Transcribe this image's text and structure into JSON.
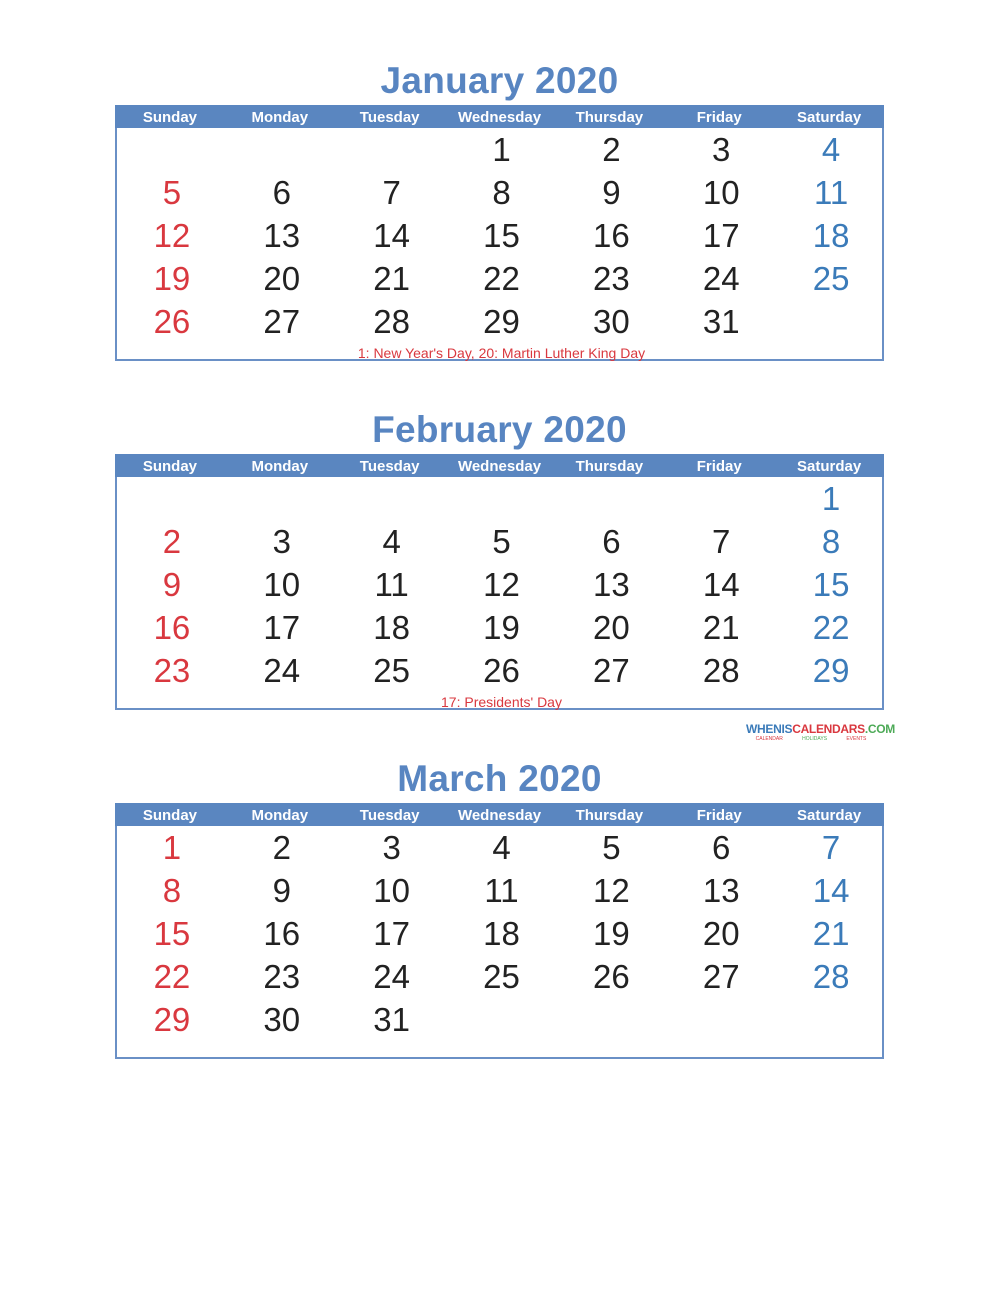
{
  "weekday_headers": [
    "Sunday",
    "Monday",
    "Tuesday",
    "Wednesday",
    "Thursday",
    "Friday",
    "Saturday"
  ],
  "colors": {
    "header_bar": "#5A86C0",
    "title": "#5885C1",
    "sunday": "#D9383F",
    "saturday": "#3B7BB9",
    "weekday": "#222222",
    "holiday_note": "#D9383F"
  },
  "months": [
    {
      "title": "January 2020",
      "weeks": [
        [
          "",
          "",
          "",
          "1",
          "2",
          "3",
          "4"
        ],
        [
          "5",
          "6",
          "7",
          "8",
          "9",
          "10",
          "11"
        ],
        [
          "12",
          "13",
          "14",
          "15",
          "16",
          "17",
          "18"
        ],
        [
          "19",
          "20",
          "21",
          "22",
          "23",
          "24",
          "25"
        ],
        [
          "26",
          "27",
          "28",
          "29",
          "30",
          "31",
          ""
        ]
      ],
      "holidays": "1: New Year's Day, 20: Martin Luther King Day"
    },
    {
      "title": "February 2020",
      "weeks": [
        [
          "",
          "",
          "",
          "",
          "",
          "",
          "1"
        ],
        [
          "2",
          "3",
          "4",
          "5",
          "6",
          "7",
          "8"
        ],
        [
          "9",
          "10",
          "11",
          "12",
          "13",
          "14",
          "15"
        ],
        [
          "16",
          "17",
          "18",
          "19",
          "20",
          "21",
          "22"
        ],
        [
          "23",
          "24",
          "25",
          "26",
          "27",
          "28",
          "29"
        ]
      ],
      "holidays": "17: Presidents' Day"
    },
    {
      "title": "March 2020",
      "weeks": [
        [
          "1",
          "2",
          "3",
          "4",
          "5",
          "6",
          "7"
        ],
        [
          "8",
          "9",
          "10",
          "11",
          "12",
          "13",
          "14"
        ],
        [
          "15",
          "16",
          "17",
          "18",
          "19",
          "20",
          "21"
        ],
        [
          "22",
          "23",
          "24",
          "25",
          "26",
          "27",
          "28"
        ],
        [
          "29",
          "30",
          "31",
          "",
          "",
          "",
          ""
        ]
      ],
      "holidays": ""
    }
  ],
  "brand": {
    "part1": "WHENIS",
    "part2": "CALENDARS",
    "part3": ".COM",
    "sub": [
      "CALENDAR",
      "HOLIDAYS",
      "EVENTS"
    ]
  }
}
